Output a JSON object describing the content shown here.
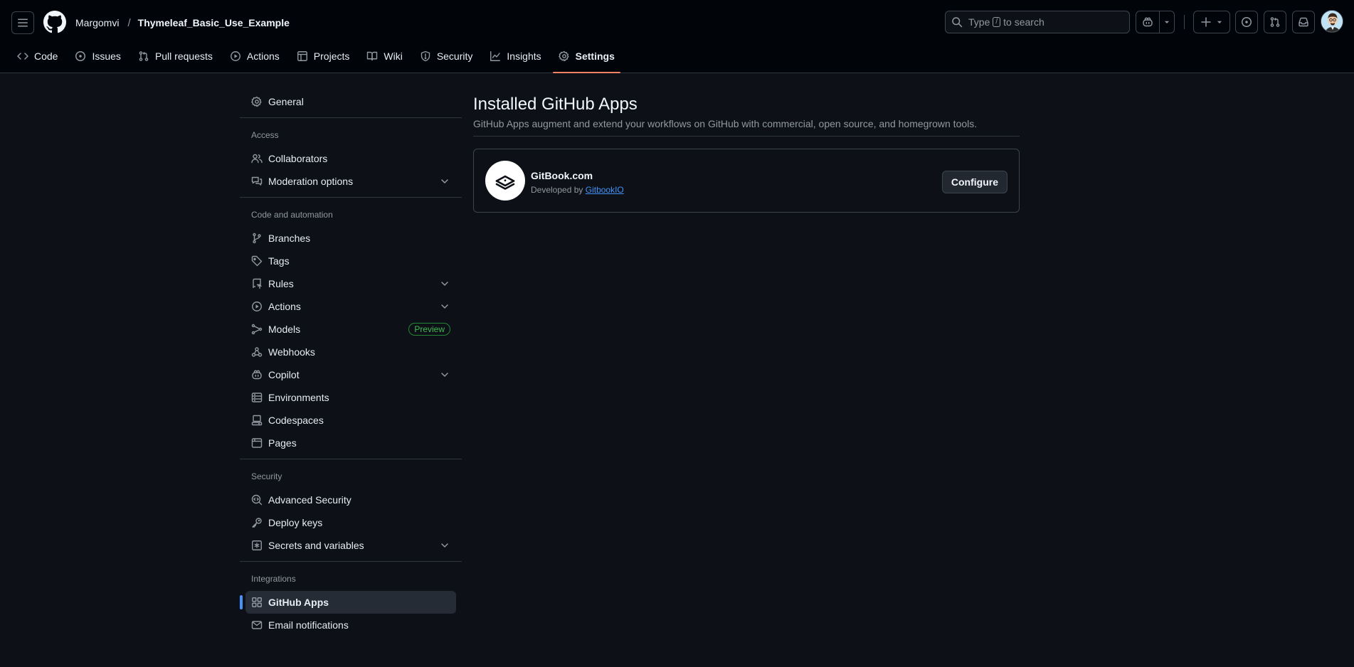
{
  "header": {
    "owner": "Margomvi",
    "separator": "/",
    "repo": "Thymeleaf_Basic_Use_Example",
    "search": {
      "before": "Type",
      "key": "/",
      "after": "to search"
    },
    "icons": [
      "hamburger-menu-icon",
      "github-mark-icon",
      "search-icon",
      "copilot-icon",
      "chevron-down-icon",
      "plus-icon",
      "issue-opened-icon",
      "git-pull-request-icon",
      "inbox-icon",
      "avatar"
    ]
  },
  "repo_nav": {
    "tabs": [
      {
        "label": "Code",
        "icon": "code-icon"
      },
      {
        "label": "Issues",
        "icon": "issue-opened-icon"
      },
      {
        "label": "Pull requests",
        "icon": "git-pull-request-icon"
      },
      {
        "label": "Actions",
        "icon": "play-icon"
      },
      {
        "label": "Projects",
        "icon": "table-icon"
      },
      {
        "label": "Wiki",
        "icon": "book-icon"
      },
      {
        "label": "Security",
        "icon": "shield-icon"
      },
      {
        "label": "Insights",
        "icon": "graph-icon"
      },
      {
        "label": "Settings",
        "icon": "gear-icon",
        "active": true
      }
    ],
    "active_color": "#f78166"
  },
  "sidebar": {
    "general": "General",
    "headings": {
      "access": "Access",
      "code_automation": "Code and automation",
      "security": "Security",
      "integrations": "Integrations"
    },
    "items": {
      "collaborators": "Collaborators",
      "moderation": "Moderation options",
      "branches": "Branches",
      "tags": "Tags",
      "rules": "Rules",
      "actions": "Actions",
      "models": "Models",
      "models_badge": "Preview",
      "webhooks": "Webhooks",
      "copilot": "Copilot",
      "environments": "Environments",
      "codespaces": "Codespaces",
      "pages": "Pages",
      "advanced_security": "Advanced Security",
      "deploy_keys": "Deploy keys",
      "secrets": "Secrets and variables",
      "github_apps": "GitHub Apps",
      "email_notifications": "Email notifications"
    },
    "active_item": "GitHub Apps",
    "accent": "#4493f8"
  },
  "main": {
    "title": "Installed GitHub Apps",
    "subtitle": "GitHub Apps augment and extend your workflows on GitHub with commercial, open source, and homegrown tools.",
    "apps": [
      {
        "name": "GitBook.com",
        "developed_by": "Developed by",
        "developer": "GitbookIO",
        "action": "Configure",
        "icon": "gitbook-logo-icon"
      }
    ]
  },
  "colors": {
    "background": "#0d1117",
    "header_bg": "#010409",
    "border": "#30363d",
    "badge_green": "#3fb950",
    "link": "#4493f8"
  }
}
